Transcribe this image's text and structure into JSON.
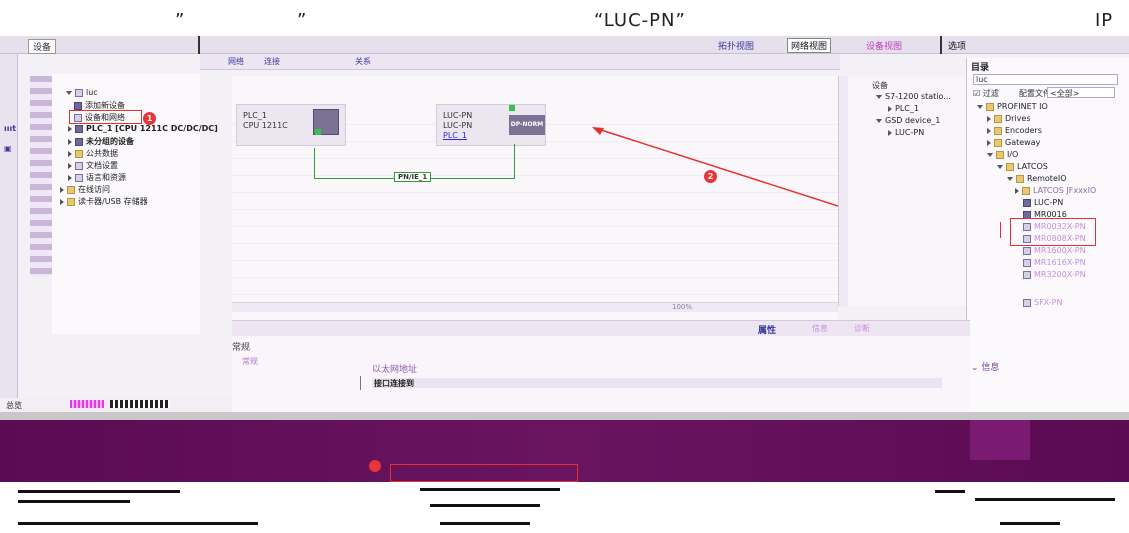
{
  "caption": {
    "quote_open": "”",
    "quote_close": "”",
    "device_name": "“LUC-PN”",
    "ip": "IP"
  },
  "title_bar": {
    "left_tab": "设备",
    "topology_view": "拓扑视图",
    "network_view": "网络视图",
    "device_view": "设备视图",
    "options": "选项"
  },
  "toolbar": {
    "network": "网络",
    "connect": "连接",
    "relations": "关系",
    "zoom": "100%"
  },
  "project_tree": {
    "items": [
      {
        "label": "luc"
      },
      {
        "label": "添加新设备"
      },
      {
        "label": "设备和网络"
      },
      {
        "label": "PLC_1 [CPU 1211C DC/DC/DC]"
      },
      {
        "label": "未分组的设备"
      },
      {
        "label": "公共数据"
      },
      {
        "label": "文档设置"
      },
      {
        "label": "语言和资源"
      },
      {
        "label": "在线访问"
      },
      {
        "label": "读卡器/USB 存储器"
      }
    ]
  },
  "network": {
    "plc": {
      "name": "PLC_1",
      "type": "CPU 1211C"
    },
    "luc": {
      "name": "LUC-PN",
      "type": "LUC-PN",
      "link": "PLC_1",
      "module": "DP-NORM"
    },
    "subnet": "PN/IE_1"
  },
  "overview": {
    "header": "设备",
    "rows": [
      "S7-1200 statio...",
      "PLC_1",
      "GSD device_1",
      "LUC-PN"
    ]
  },
  "catalog": {
    "header": "目录",
    "search": "luc",
    "filter": "过滤",
    "profile_label": "配置文件",
    "profile_value": "<全部>",
    "items": [
      {
        "label": "PROFINET IO"
      },
      {
        "label": "Drives"
      },
      {
        "label": "Encoders"
      },
      {
        "label": "Gateway"
      },
      {
        "label": "I/O"
      },
      {
        "label": "LATCOS"
      },
      {
        "label": "RemoteIO"
      },
      {
        "label": "LATCOS JFxxxIO"
      },
      {
        "label": "LUC-PN"
      },
      {
        "label": "MR0016"
      },
      {
        "label": "MR0032X-PN"
      },
      {
        "label": "MR0808X-PN"
      },
      {
        "label": "MR1600X-PN"
      },
      {
        "label": "MR1616X-PN"
      },
      {
        "label": "MR3200X-PN"
      },
      {
        "label": "SFX-PN"
      }
    ],
    "info": "信息"
  },
  "properties": {
    "tabs": [
      "属性",
      "信息",
      "诊断"
    ],
    "general": "常规",
    "general_sub": "常规",
    "ethernet_address": "以太网地址",
    "interface_connected": "接口连接到"
  },
  "bottom": {
    "portal_view": "总览"
  },
  "badges": [
    "1",
    "2"
  ],
  "colors": {
    "annotation_red": "#e53030",
    "accent_pink": "#e03de0",
    "subnet_green": "#2e9e3a"
  }
}
